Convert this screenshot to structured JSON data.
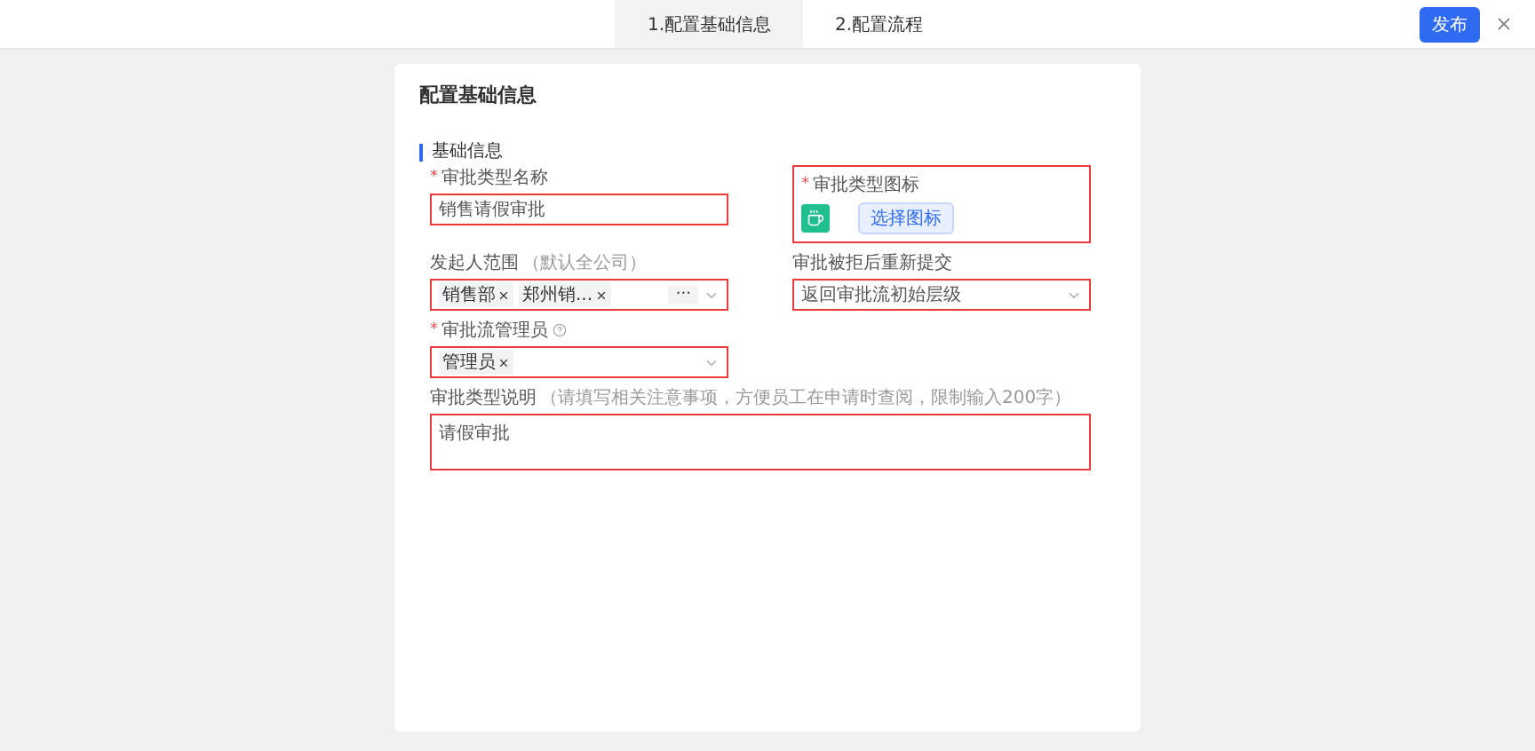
{
  "header": {
    "steps": [
      {
        "label": "1.配置基础信息",
        "selected": true
      },
      {
        "label": "2.配置流程",
        "selected": false
      }
    ],
    "publish_button": "发布"
  },
  "card": {
    "title": "配置基础信息",
    "section": "基础信息",
    "fields": [
      {
        "kind": "text",
        "label": "审批类型名称",
        "required_mark": "*",
        "value": "销售请假审批"
      },
      {
        "kind": "icon",
        "label": "审批类型图标",
        "required_mark": "*",
        "button": "选择图标"
      },
      {
        "kind": "tags",
        "label": "发起人范围",
        "hint": "（默认全公司）",
        "tags": [
          {
            "label": "销售部"
          },
          {
            "label": "郑州销..."
          }
        ],
        "more": "···"
      },
      {
        "kind": "select",
        "label": "审批被拒后重新提交",
        "value": "返回审批流初始层级"
      },
      {
        "kind": "tags",
        "label": "审批流管理员",
        "required_mark": "*",
        "help_icon": true,
        "tags": [
          {
            "label": "管理员"
          }
        ]
      },
      {
        "kind": "textarea",
        "label": "审批类型说明",
        "hint": "（请填写相关注意事项，方便员工在申请时查阅，限制输入200字）",
        "value": "请假审批"
      }
    ]
  }
}
